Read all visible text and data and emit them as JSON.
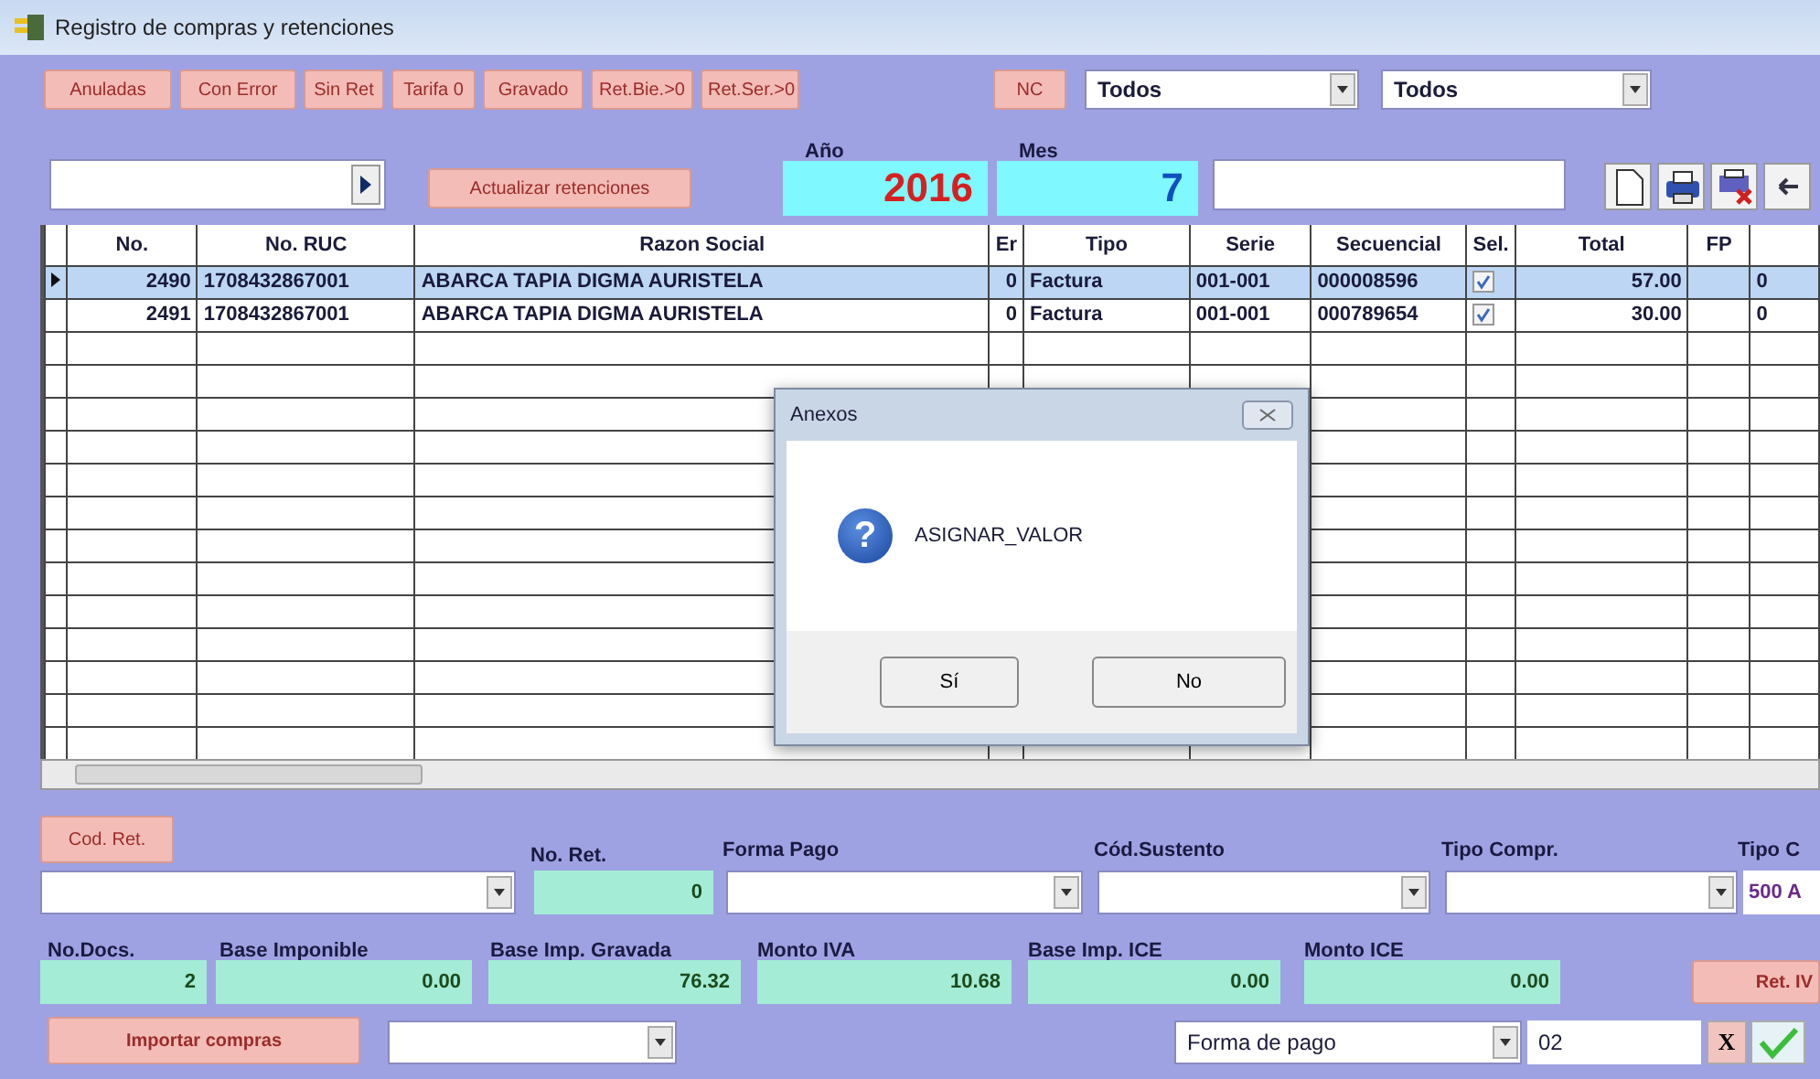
{
  "window": {
    "title": "Registro de compras y retenciones"
  },
  "filter_buttons": [
    "Anuladas",
    "Con Error",
    "Sin Ret",
    "Tarifa 0",
    "Gravado",
    "Ret.Bie.>0",
    "Ret.Ser.>0"
  ],
  "nc_button": "NC",
  "filters": [
    {
      "value": "Todos"
    },
    {
      "value": "Todos"
    }
  ],
  "update_button": "Actualizar retenciones",
  "year": {
    "label": "Año",
    "value": "2016"
  },
  "month": {
    "label": "Mes",
    "value": "7"
  },
  "table": {
    "columns": [
      "No.",
      "No. RUC",
      "Razon Social",
      "Er",
      "Tipo",
      "Serie",
      "Secuencial",
      "Sel.",
      "Total",
      "FP"
    ],
    "rows": [
      {
        "selected": true,
        "no": "2490",
        "ruc": "1708432867001",
        "razon": "ABARCA TAPIA DIGMA AURISTELA",
        "er": "0",
        "tipo": "Factura",
        "serie": "001-001",
        "secuencial": "000008596",
        "checked": true,
        "total": "57.00",
        "column_11": "0"
      },
      {
        "selected": false,
        "no": "2491",
        "ruc": "1708432867001",
        "razon": "ABARCA TAPIA DIGMA AURISTELA",
        "er": "0",
        "tipo": "Factura",
        "serie": "001-001",
        "secuencial": "000789654",
        "checked": true,
        "total": "30.00",
        "column_11": "0"
      }
    ]
  },
  "dialog": {
    "title": "Anexos",
    "icon": "?",
    "message": "ASIGNAR_VALOR",
    "buttons": [
      "Sí",
      "No"
    ]
  },
  "cod_ret_button": "Cod. Ret.",
  "combo_labels": [
    {
      "label": "No. Ret."
    },
    {
      "label": "Forma Pago"
    },
    {
      "label": "Cód.Sustento"
    },
    {
      "label": "Tipo Compr."
    },
    {
      "label": "Tipo C"
    }
  ],
  "no_ret": "0",
  "tipo_c_value": "500 A",
  "totals": [
    {
      "label": "No.Docs.",
      "value": "2"
    },
    {
      "label": "Base Imponible",
      "value": "0.00"
    },
    {
      "label": "Base Imp. Gravada",
      "value": "76.32"
    },
    {
      "label": "Monto IVA",
      "value": "10.68"
    },
    {
      "label": "Base Imp. ICE",
      "value": "0.00"
    },
    {
      "label": "Monto ICE",
      "value": "0.00"
    }
  ],
  "ret_iva_button": "Ret. IV",
  "import_button": "Importar compras",
  "payment_select": "Forma de pago",
  "payment_code": "02",
  "cancel_button": "X"
}
